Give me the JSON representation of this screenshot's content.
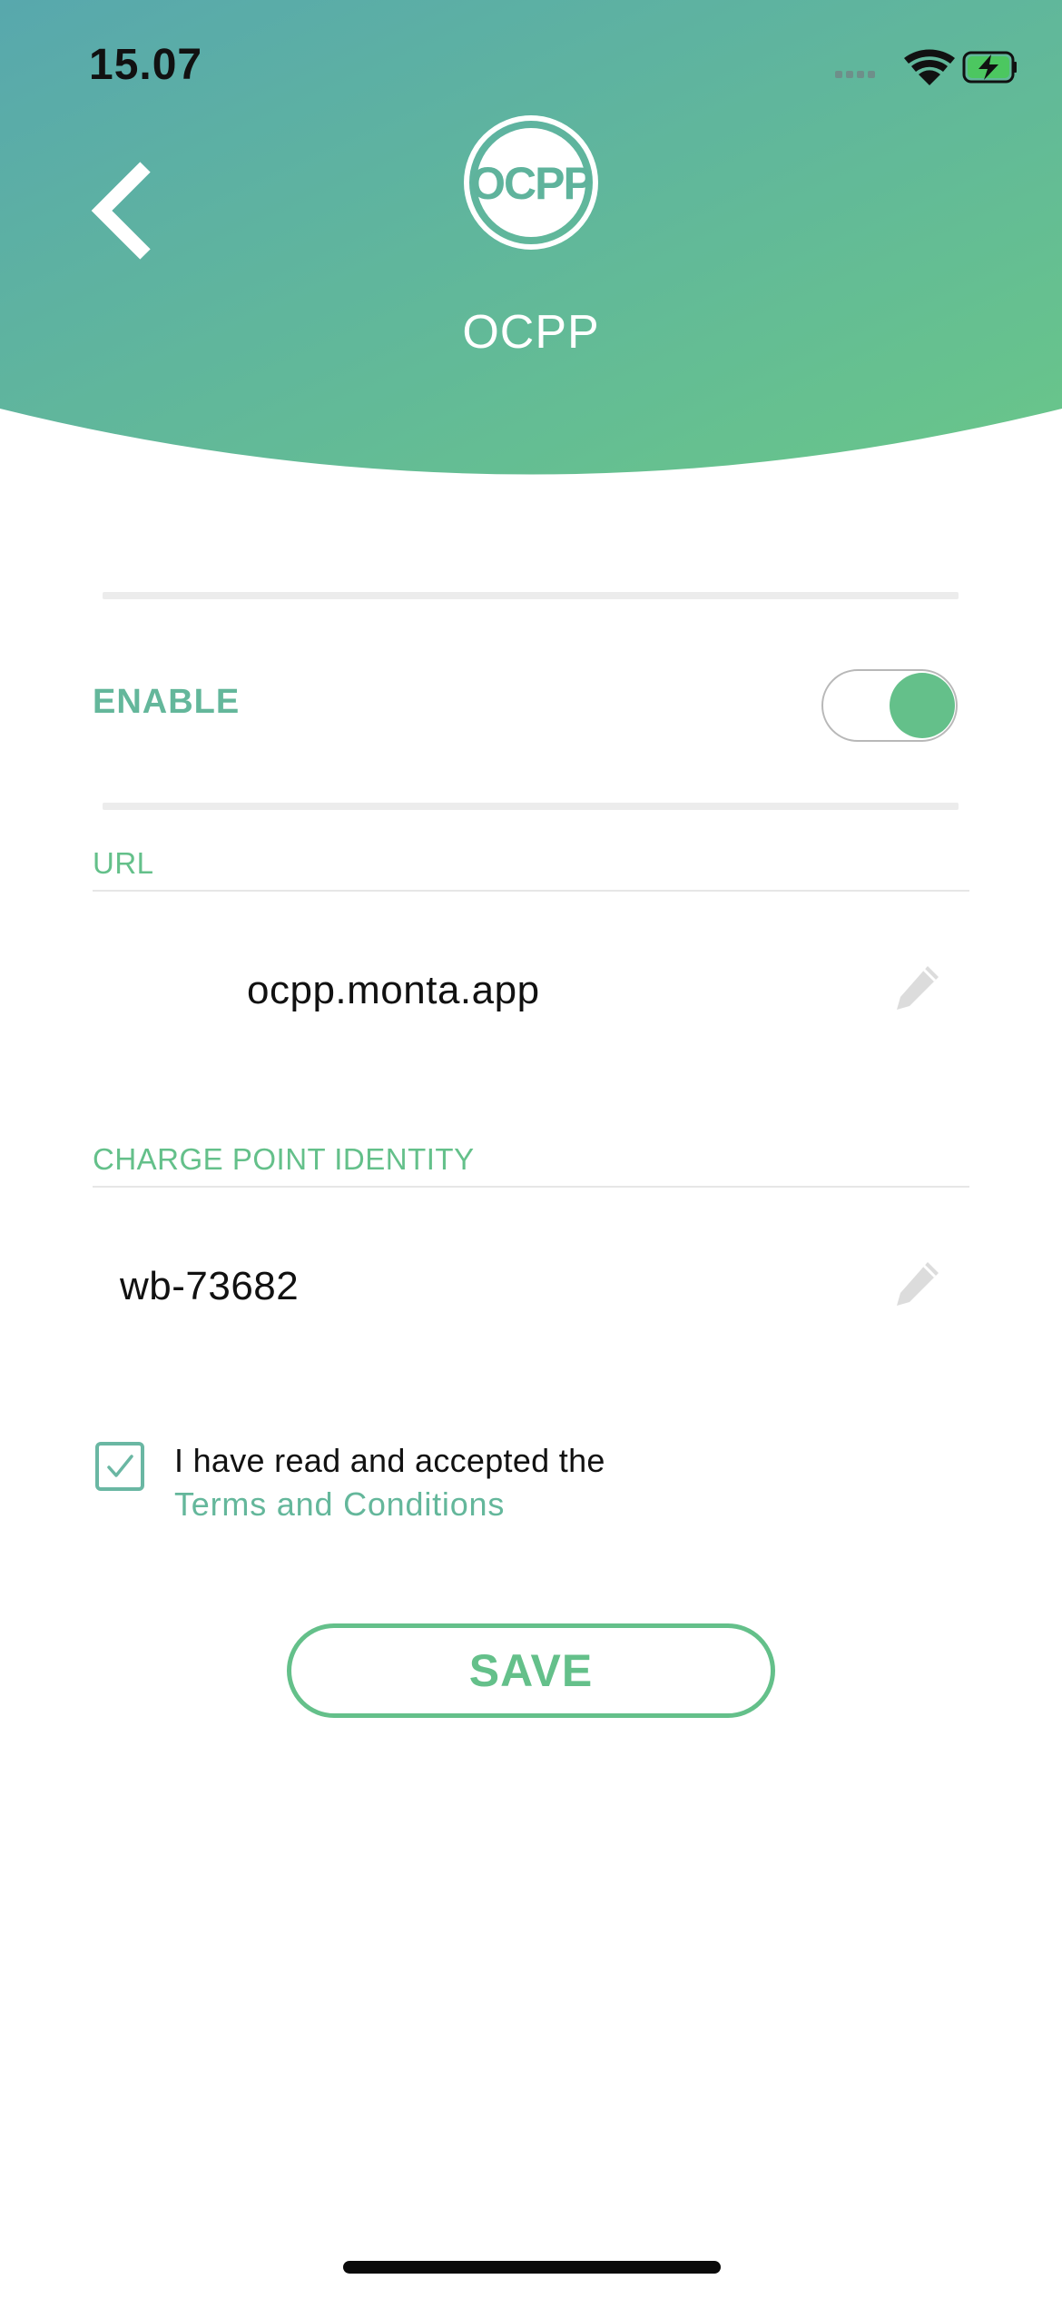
{
  "status_bar": {
    "time": "15.07",
    "icons": [
      "cellular-signal-icon",
      "wifi-icon",
      "battery-charging-icon"
    ]
  },
  "header": {
    "title": "OCPP",
    "logo_text": "OCPP",
    "back_icon": "chevron-left-icon",
    "gradient_colors": [
      "#5aa9ab",
      "#68c58a"
    ]
  },
  "settings": {
    "enable_label": "ENABLE",
    "enable_on": true,
    "url_label": "URL",
    "url_value": "ocpp.monta.app",
    "identity_label": "CHARGE POINT IDENTITY",
    "identity_value": "wb-73682",
    "edit_icon": "pencil-icon"
  },
  "terms": {
    "checked": true,
    "text": "I have read and accepted the",
    "link": "Terms and Conditions"
  },
  "save_label": "SAVE",
  "colors": {
    "accent": "#64c08a",
    "label_teal": "#64b79b"
  }
}
